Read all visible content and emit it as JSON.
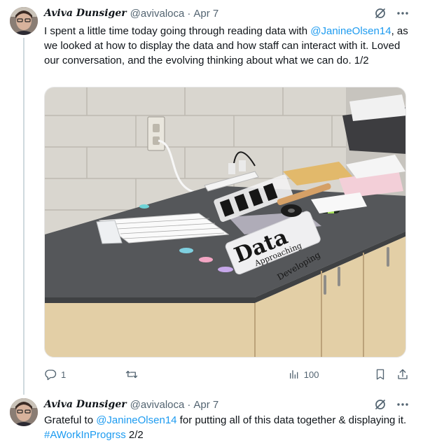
{
  "tweets": [
    {
      "author_name": "Aviva Dunsiger",
      "handle": "@avivaloca",
      "dot": "·",
      "date": "Apr 7",
      "text_1": "I spent a little time today going through reading data with ",
      "mention": "@JanineOlsen14",
      "text_2": ", as we looked at how to display the data and how staff can interact with it. Loved our conversation, and the evolving thinking about what we can do. 1/2",
      "photo_text": {
        "big": "Data",
        "approaching": "Approaching",
        "developing": "Developing"
      },
      "replies": "1",
      "views": "100"
    },
    {
      "author_name": "Aviva Dunsiger",
      "handle": "@avivaloca",
      "dot": "·",
      "date": "Apr 7",
      "text_1": "Grateful to ",
      "mention": "@JanineOlsen14",
      "text_2": " for putting all of this data together & displaying it. ",
      "hashtag": "#AWorkInProgrss",
      "text_3": " 2/2"
    }
  ],
  "colors": {
    "link": "#1d9bf0",
    "muted": "#536471",
    "thread_line": "#cfd9de"
  }
}
